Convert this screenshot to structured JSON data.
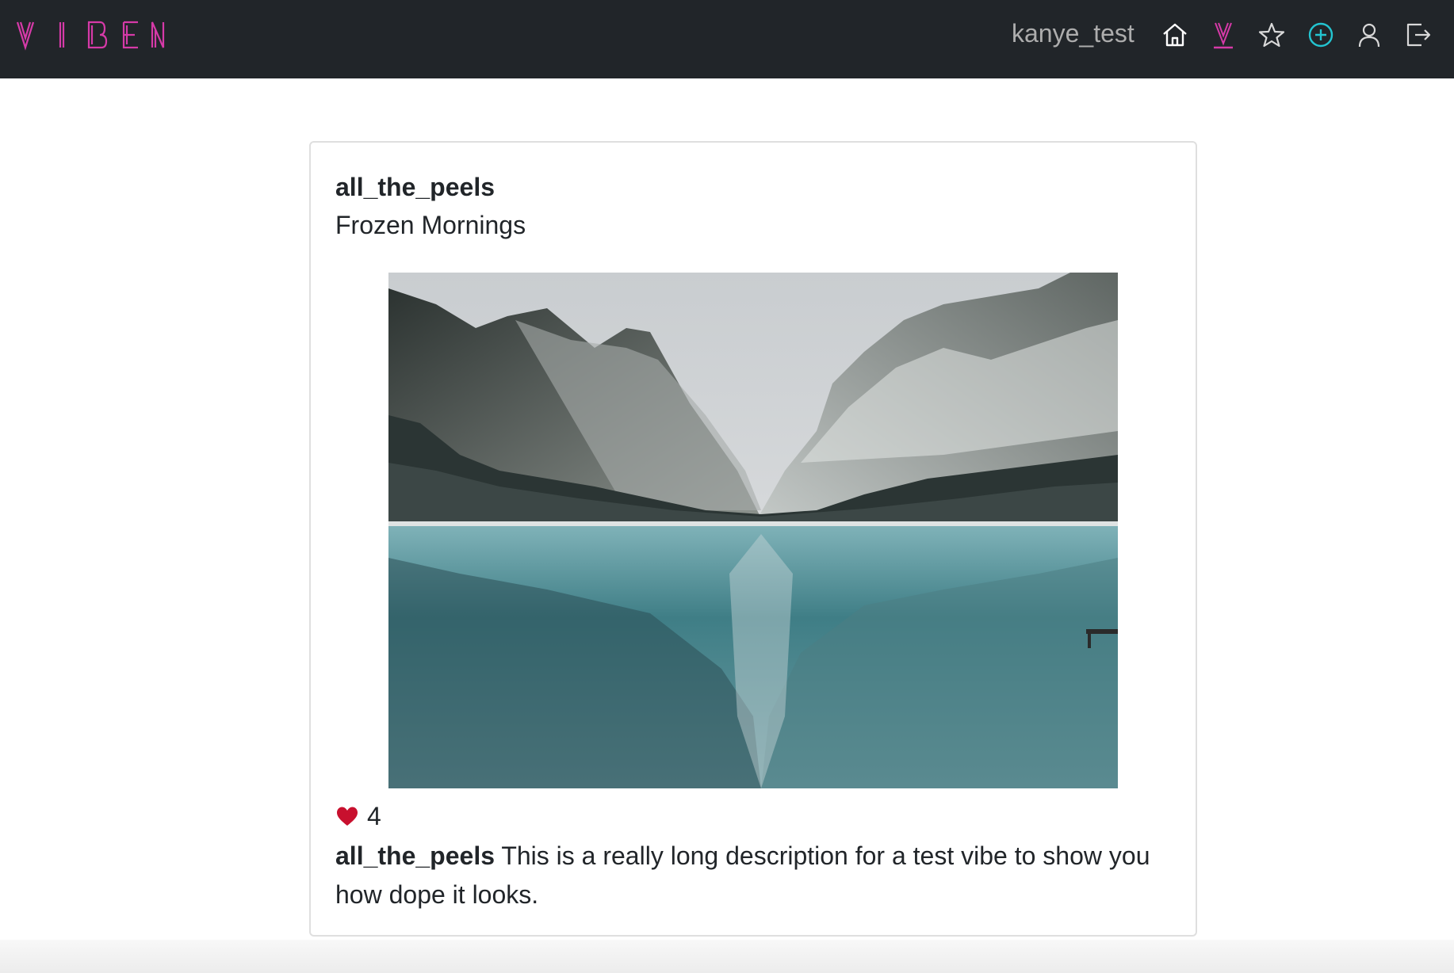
{
  "app": {
    "brand_text": "VIBEN",
    "colors": {
      "navbar_bg": "#212529",
      "brand": "#d63aa8",
      "add_icon": "#23c4d0",
      "heart": "#c8102e"
    }
  },
  "navbar": {
    "username": "kanye_test",
    "icons": [
      "home-icon",
      "vibes-v-icon",
      "star-icon",
      "plus-circle-icon",
      "user-icon",
      "logout-icon"
    ],
    "vibes_icon_letter": "V"
  },
  "post": {
    "author": "all_the_peels",
    "title": "Frozen Mornings",
    "likes": "4",
    "caption_author": "all_the_peels",
    "caption_text": " This is a really long description for a test vibe to show you how dope it looks."
  }
}
